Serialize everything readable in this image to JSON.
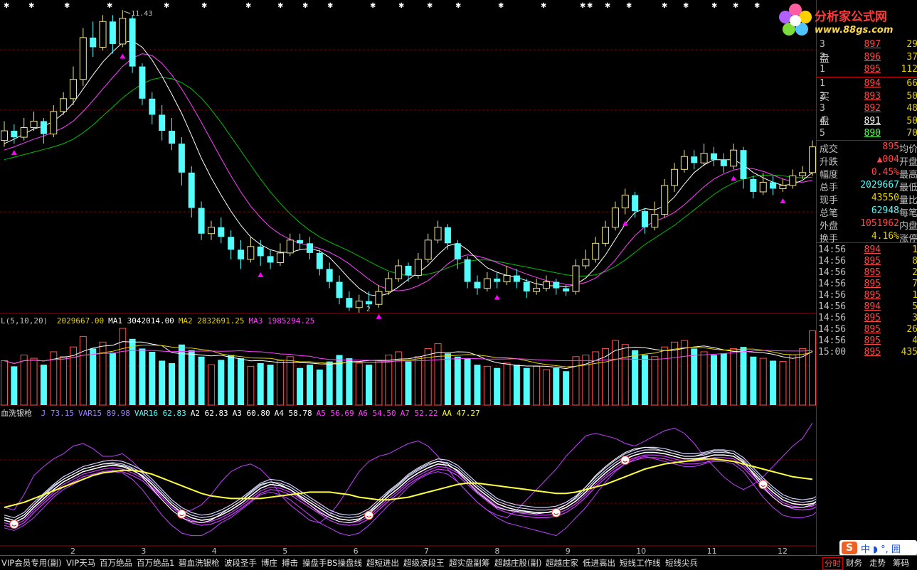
{
  "colors": {
    "up": "#ff5050",
    "up_body": "#f0e68c",
    "down": "#54fcfc",
    "ma_white": "#ffffff",
    "ma_pink": "#ff40ff",
    "ma_green": "#00c000",
    "magenta": "#ff00ff",
    "yellow": "#ffff40",
    "grid": "#7a0000"
  },
  "top_indicator_labels": [
    "11.43"
  ],
  "low_label": "2",
  "volume_panel": {
    "title": "L(5,10,20)",
    "items": [
      {
        "label": "2029667.00",
        "color": "#e6d200"
      },
      {
        "label": "MA1 3042014.00",
        "color": "#ffffff"
      },
      {
        "label": "MA2 2832691.25",
        "color": "#e6d200"
      },
      {
        "label": "MA3 1985294.25",
        "color": "#ff40ff"
      }
    ]
  },
  "indicator_panel": {
    "title": "血洗银枪",
    "items": [
      {
        "label": "J 73.15",
        "color": "#a080ff"
      },
      {
        "label": "VAR15 89.98",
        "color": "#a080ff"
      },
      {
        "label": "VAR16 62.83",
        "color": "#54fcfc"
      },
      {
        "label": "A2 62.83",
        "color": "#ffffff"
      },
      {
        "label": "A3 60.80",
        "color": "#ffffff"
      },
      {
        "label": "A4 58.78",
        "color": "#ffffff"
      },
      {
        "label": "A5 56.69",
        "color": "#ff40ff"
      },
      {
        "label": "A6 54.50",
        "color": "#ff40ff"
      },
      {
        "label": "A7 52.22",
        "color": "#ff40ff"
      },
      {
        "label": "AA 47.27",
        "color": "#ffff40"
      }
    ]
  },
  "chart_data": {
    "type": "candlestick",
    "x_tick_labels": [
      "2",
      "3",
      "4",
      "5",
      "6",
      "7",
      "8",
      "9",
      "10",
      "11",
      "12"
    ],
    "price_max_label": "11.43",
    "candles": [
      [
        9.4,
        9.55,
        9.7,
        9.3
      ],
      [
        9.55,
        9.45,
        9.65,
        9.35
      ],
      [
        9.45,
        9.6,
        9.75,
        9.4
      ],
      [
        9.6,
        9.7,
        9.85,
        9.55
      ],
      [
        9.7,
        9.5,
        9.75,
        9.35
      ],
      [
        9.5,
        9.85,
        9.95,
        9.45
      ],
      [
        9.85,
        10.05,
        10.15,
        9.8
      ],
      [
        10.05,
        10.35,
        10.55,
        9.95
      ],
      [
        10.35,
        11.0,
        11.15,
        10.25
      ],
      [
        11.0,
        10.85,
        11.25,
        10.7
      ],
      [
        10.85,
        11.25,
        11.35,
        10.8
      ],
      [
        11.25,
        10.9,
        11.35,
        10.75
      ],
      [
        10.9,
        11.3,
        11.43,
        10.85
      ],
      [
        11.3,
        10.55,
        11.35,
        10.45
      ],
      [
        10.55,
        10.05,
        10.6,
        9.95
      ],
      [
        10.05,
        9.8,
        10.15,
        9.65
      ],
      [
        9.8,
        9.55,
        9.95,
        9.4
      ],
      [
        9.55,
        9.35,
        9.75,
        9.25
      ],
      [
        9.35,
        8.9,
        9.45,
        8.7
      ],
      [
        8.9,
        8.35,
        9.0,
        8.2
      ],
      [
        8.35,
        7.95,
        8.45,
        7.85
      ],
      [
        7.95,
        8.05,
        8.15,
        7.85
      ],
      [
        8.05,
        7.9,
        8.2,
        7.8
      ],
      [
        7.9,
        7.7,
        8.0,
        7.55
      ],
      [
        7.7,
        7.55,
        7.85,
        7.4
      ],
      [
        7.55,
        7.75,
        7.9,
        7.5
      ],
      [
        7.75,
        7.6,
        7.85,
        7.45
      ],
      [
        7.6,
        7.5,
        7.7,
        7.4
      ],
      [
        7.5,
        7.65,
        7.8,
        7.45
      ],
      [
        7.65,
        7.85,
        7.95,
        7.6
      ],
      [
        7.85,
        7.8,
        7.95,
        7.7
      ],
      [
        7.8,
        7.65,
        7.9,
        7.55
      ],
      [
        7.65,
        7.4,
        7.7,
        7.3
      ],
      [
        7.4,
        7.2,
        7.5,
        7.1
      ],
      [
        7.2,
        6.95,
        7.3,
        6.85
      ],
      [
        6.95,
        6.8,
        7.05,
        6.75
      ],
      [
        6.8,
        6.9,
        7.0,
        6.72
      ],
      [
        6.9,
        6.85,
        7.05,
        6.78
      ],
      [
        6.85,
        7.05,
        7.15,
        6.8
      ],
      [
        7.05,
        7.25,
        7.35,
        7.0
      ],
      [
        7.25,
        7.45,
        7.55,
        7.2
      ],
      [
        7.45,
        7.3,
        7.5,
        7.2
      ],
      [
        7.3,
        7.55,
        7.65,
        7.25
      ],
      [
        7.55,
        7.85,
        7.95,
        7.5
      ],
      [
        7.85,
        8.05,
        8.15,
        7.8
      ],
      [
        8.05,
        7.8,
        8.1,
        7.7
      ],
      [
        7.8,
        7.55,
        7.85,
        7.4
      ],
      [
        7.55,
        7.2,
        7.6,
        7.1
      ],
      [
        7.2,
        7.1,
        7.3,
        7.0
      ],
      [
        7.1,
        7.25,
        7.35,
        7.05
      ],
      [
        7.25,
        7.2,
        7.35,
        7.1
      ],
      [
        7.2,
        7.3,
        7.45,
        7.15
      ],
      [
        7.3,
        7.2,
        7.4,
        7.1
      ],
      [
        7.2,
        7.05,
        7.25,
        6.95
      ],
      [
        7.05,
        7.1,
        7.25,
        7.0
      ],
      [
        7.1,
        7.2,
        7.3,
        7.05
      ],
      [
        7.2,
        7.1,
        7.25,
        7.0
      ],
      [
        7.1,
        7.05,
        7.15,
        6.98
      ],
      [
        7.05,
        7.45,
        7.55,
        7.0
      ],
      [
        7.45,
        7.55,
        7.7,
        7.4
      ],
      [
        7.55,
        7.8,
        7.9,
        7.5
      ],
      [
        7.8,
        8.05,
        8.15,
        7.75
      ],
      [
        8.05,
        8.35,
        8.45,
        8.0
      ],
      [
        8.35,
        8.55,
        8.65,
        8.25
      ],
      [
        8.55,
        8.3,
        8.6,
        8.2
      ],
      [
        8.3,
        8.05,
        8.35,
        7.95
      ],
      [
        8.05,
        8.25,
        8.45,
        8.0
      ],
      [
        8.25,
        8.7,
        8.8,
        8.2
      ],
      [
        8.7,
        8.95,
        9.05,
        8.6
      ],
      [
        8.95,
        9.15,
        9.25,
        8.9
      ],
      [
        9.15,
        9.05,
        9.25,
        8.95
      ],
      [
        9.05,
        9.2,
        9.35,
        9.0
      ],
      [
        9.2,
        9.1,
        9.3,
        9.0
      ],
      [
        9.1,
        9.0,
        9.2,
        8.9
      ],
      [
        9.0,
        9.25,
        9.35,
        8.95
      ],
      [
        9.25,
        8.8,
        9.3,
        8.65
      ],
      [
        8.8,
        8.6,
        8.85,
        8.5
      ],
      [
        8.6,
        8.75,
        8.9,
        8.55
      ],
      [
        8.75,
        8.65,
        8.85,
        8.55
      ],
      [
        8.65,
        8.7,
        8.8,
        8.6
      ],
      [
        8.7,
        8.85,
        8.95,
        8.65
      ],
      [
        8.85,
        8.9,
        9.0,
        8.8
      ],
      [
        8.9,
        9.3,
        9.4,
        8.85
      ]
    ],
    "ma_white": [
      9.35,
      9.42,
      9.5,
      9.58,
      9.62,
      9.7,
      9.82,
      9.98,
      10.2,
      10.42,
      10.62,
      10.78,
      10.92,
      10.95,
      10.85,
      10.65,
      10.4,
      10.12,
      9.82,
      9.48,
      9.12,
      8.82,
      8.55,
      8.3,
      8.08,
      7.9,
      7.78,
      7.7,
      7.66,
      7.66,
      7.7,
      7.72,
      7.68,
      7.58,
      7.42,
      7.25,
      7.1,
      7.0,
      6.98,
      7.02,
      7.12,
      7.24,
      7.34,
      7.46,
      7.62,
      7.76,
      7.8,
      7.7,
      7.55,
      7.42,
      7.35,
      7.3,
      7.27,
      7.22,
      7.17,
      7.14,
      7.14,
      7.12,
      7.16,
      7.26,
      7.42,
      7.62,
      7.86,
      8.1,
      8.28,
      8.34,
      8.32,
      8.38,
      8.52,
      8.72,
      8.9,
      9.02,
      9.1,
      9.1,
      9.1,
      9.02,
      8.9,
      8.82,
      8.75,
      8.7,
      8.72,
      8.78,
      8.9
    ],
    "ma_pink": [
      9.25,
      9.3,
      9.36,
      9.42,
      9.47,
      9.53,
      9.6,
      9.7,
      9.85,
      10.02,
      10.2,
      10.38,
      10.55,
      10.68,
      10.75,
      10.72,
      10.6,
      10.42,
      10.2,
      9.95,
      9.68,
      9.4,
      9.12,
      8.85,
      8.6,
      8.38,
      8.2,
      8.05,
      7.94,
      7.86,
      7.8,
      7.76,
      7.72,
      7.66,
      7.58,
      7.48,
      7.36,
      7.24,
      7.14,
      7.08,
      7.06,
      7.08,
      7.14,
      7.22,
      7.34,
      7.48,
      7.58,
      7.62,
      7.6,
      7.56,
      7.5,
      7.44,
      7.38,
      7.32,
      7.27,
      7.22,
      7.19,
      7.16,
      7.16,
      7.19,
      7.26,
      7.38,
      7.54,
      7.74,
      7.92,
      8.06,
      8.14,
      8.2,
      8.28,
      8.4,
      8.54,
      8.68,
      8.8,
      8.88,
      8.94,
      8.97,
      8.96,
      8.92,
      8.86,
      8.8,
      8.76,
      8.75,
      8.78
    ],
    "ma_green": [
      9.1,
      9.14,
      9.18,
      9.22,
      9.26,
      9.3,
      9.35,
      9.42,
      9.52,
      9.64,
      9.78,
      9.92,
      10.06,
      10.18,
      10.28,
      10.35,
      10.38,
      10.36,
      10.3,
      10.2,
      10.06,
      9.88,
      9.68,
      9.46,
      9.24,
      9.02,
      8.8,
      8.6,
      8.42,
      8.26,
      8.12,
      8.0,
      7.9,
      7.82,
      7.75,
      7.68,
      7.6,
      7.52,
      7.44,
      7.37,
      7.32,
      7.3,
      7.3,
      7.32,
      7.36,
      7.42,
      7.48,
      7.52,
      7.54,
      7.54,
      7.52,
      7.49,
      7.46,
      7.43,
      7.4,
      7.37,
      7.34,
      7.31,
      7.29,
      7.29,
      7.31,
      7.36,
      7.44,
      7.54,
      7.66,
      7.78,
      7.88,
      7.98,
      8.08,
      8.2,
      8.32,
      8.44,
      8.56,
      8.66,
      8.74,
      8.8,
      8.84,
      8.86,
      8.86,
      8.85,
      8.83,
      8.82,
      8.83
    ],
    "volume": [
      0.55,
      0.48,
      0.62,
      0.58,
      0.5,
      0.66,
      0.6,
      0.72,
      0.85,
      0.7,
      0.78,
      0.65,
      0.95,
      0.82,
      0.7,
      0.66,
      0.55,
      0.52,
      0.75,
      0.68,
      0.6,
      0.5,
      0.56,
      0.62,
      0.58,
      0.48,
      0.52,
      0.5,
      0.55,
      0.6,
      0.46,
      0.5,
      0.44,
      0.54,
      0.62,
      0.58,
      0.52,
      0.5,
      0.55,
      0.62,
      0.66,
      0.54,
      0.6,
      0.7,
      0.76,
      0.64,
      0.6,
      0.58,
      0.5,
      0.48,
      0.46,
      0.52,
      0.5,
      0.46,
      0.48,
      0.44,
      0.46,
      0.42,
      0.6,
      0.62,
      0.66,
      0.7,
      0.8,
      0.75,
      0.68,
      0.62,
      0.6,
      0.72,
      0.78,
      0.8,
      0.7,
      0.66,
      0.62,
      0.64,
      0.7,
      0.72,
      0.6,
      0.58,
      0.55,
      0.54,
      0.62,
      0.7,
      0.92
    ],
    "ind_yellow": [
      30,
      32,
      34,
      37,
      40,
      43,
      46,
      49,
      52,
      55,
      57,
      58,
      59,
      59,
      58,
      56,
      53,
      50,
      47,
      44,
      41,
      39,
      38,
      37,
      37,
      37,
      37,
      38,
      39,
      40,
      41,
      42,
      42,
      42,
      41,
      40,
      38,
      37,
      36,
      36,
      37,
      38,
      40,
      42,
      44,
      46,
      48,
      49,
      49,
      48,
      47,
      46,
      45,
      44,
      43,
      42,
      41,
      41,
      42,
      44,
      46,
      48,
      51,
      54,
      57,
      60,
      62,
      64,
      65,
      66,
      67,
      68,
      68,
      67,
      66,
      64,
      62,
      60,
      58,
      56,
      54,
      53,
      52
    ],
    "ind_white": [
      22,
      20,
      24,
      32,
      40,
      47,
      52,
      56,
      60,
      62,
      64,
      64,
      63,
      60,
      54,
      45,
      36,
      28,
      22,
      19,
      18,
      20,
      25,
      30,
      35,
      42,
      48,
      50,
      48,
      44,
      38,
      32,
      26,
      22,
      19,
      18,
      20,
      26,
      34,
      42,
      48,
      55,
      60,
      64,
      66,
      64,
      58,
      50,
      42,
      36,
      30,
      28,
      27,
      26,
      25,
      26,
      28,
      32,
      38,
      46,
      55,
      62,
      68,
      73,
      76,
      77,
      76,
      74,
      72,
      70,
      70,
      72,
      74,
      74,
      72,
      66,
      56,
      46,
      38,
      32,
      30,
      30,
      32,
      38,
      46,
      56,
      62
    ],
    "ind_mag": [
      20,
      18,
      22,
      30,
      37,
      44,
      50,
      54,
      58,
      60,
      62,
      63,
      62,
      59,
      55,
      48,
      40,
      32,
      26,
      22,
      20,
      21,
      24,
      28,
      33,
      39,
      45,
      48,
      47,
      44,
      39,
      34,
      29,
      24,
      21,
      20,
      21,
      25,
      32,
      39,
      45,
      52,
      57,
      61,
      64,
      63,
      59,
      52,
      45,
      39,
      33,
      30,
      28,
      27,
      26,
      26,
      27,
      30,
      35,
      42,
      50,
      57,
      63,
      68,
      71,
      73,
      73,
      72,
      70,
      68,
      68,
      69,
      71,
      71,
      70,
      65,
      57,
      49,
      42,
      36,
      33,
      32,
      33,
      37,
      44,
      52,
      58
    ],
    "ind_upper": [
      30,
      28,
      40,
      55,
      62,
      68,
      72,
      78,
      80,
      76,
      70,
      70,
      72,
      66,
      58,
      48,
      38,
      30,
      26,
      28,
      32,
      40,
      50,
      58,
      62,
      64,
      60,
      52,
      40,
      32,
      26,
      20,
      18,
      24,
      34,
      46,
      58,
      66,
      70,
      72,
      76,
      80,
      82,
      78,
      70,
      60,
      50,
      42,
      34,
      28,
      24,
      22,
      28,
      36,
      44,
      52,
      60,
      70,
      78,
      86,
      88,
      86,
      84,
      80,
      78,
      82,
      86,
      90,
      92,
      88,
      80,
      70,
      62,
      54,
      48,
      44,
      48,
      54,
      62,
      70,
      78,
      84,
      96
    ],
    "ind_lower": [
      14,
      12,
      16,
      22,
      30,
      38,
      44,
      48,
      52,
      55,
      57,
      58,
      57,
      52,
      44,
      34,
      24,
      16,
      10,
      8,
      8,
      12,
      18,
      22,
      28,
      34,
      40,
      42,
      40,
      36,
      30,
      24,
      18,
      14,
      10,
      8,
      10,
      16,
      24,
      32,
      38,
      46,
      52,
      56,
      58,
      56,
      50,
      42,
      34,
      28,
      22,
      18,
      16,
      14,
      12,
      10,
      8,
      14,
      22,
      30,
      40,
      50,
      58,
      64,
      68,
      70,
      68,
      66,
      64,
      62,
      62,
      64,
      66,
      66,
      64,
      58,
      48,
      38,
      30,
      24,
      22,
      22,
      24,
      30,
      38,
      48,
      56
    ]
  },
  "quote": {
    "logo": {
      "name": "分析家公式网",
      "url": "www.88gs.com"
    },
    "sell": [
      {
        "idx": "3",
        "price": "897",
        "vol": "29",
        "color": "#ff4848"
      },
      {
        "idx": "2",
        "price": "896",
        "vol": "37",
        "color": "#ff4848"
      },
      {
        "idx": "1",
        "price": "895",
        "vol": "112",
        "color": "#ff4848"
      }
    ],
    "sell_label": [
      "盘"
    ],
    "buy": [
      {
        "idx": "1",
        "price": "894",
        "vol": "66",
        "color": "#ff4848"
      },
      {
        "idx": "2",
        "price": "893",
        "vol": "50",
        "color": "#ff4848"
      },
      {
        "idx": "3",
        "price": "892",
        "vol": "48",
        "color": "#ff4848"
      },
      {
        "idx": "4",
        "price": "891",
        "vol": "50",
        "color": "#ffffff"
      },
      {
        "idx": "5",
        "price": "890",
        "vol": "70",
        "color": "#54fc54"
      }
    ],
    "buy_label": [
      "买",
      "盘"
    ],
    "stats": [
      {
        "k": "成交",
        "v": "895",
        "k2": "均价",
        "color": "#ff4848"
      },
      {
        "k": "升跌",
        "v": "▲004",
        "k2": "开盘",
        "color": "#ff4848"
      },
      {
        "k": "幅度",
        "v": "0.45%",
        "k2": "最高",
        "color": "#ff4848"
      },
      {
        "k": "总手",
        "v": "2029667",
        "k2": "最低",
        "color": "#54fcfc"
      },
      {
        "k": "现手",
        "v": "43550",
        "k2": "量比",
        "color": "#e6d200"
      },
      {
        "k": "总笔",
        "v": "62948",
        "k2": "每笔",
        "color": "#54fcfc"
      },
      {
        "k": "外盘",
        "v": "1051962",
        "k2": "内盘",
        "color": "#ff4848"
      },
      {
        "k": "换手",
        "v": "4.16%",
        "k2": "涨停",
        "color": "#e6d200"
      }
    ],
    "ticks": [
      {
        "t": "14:56",
        "p": "894",
        "v": "1"
      },
      {
        "t": "14:56",
        "p": "895",
        "v": "8"
      },
      {
        "t": "14:56",
        "p": "895",
        "v": "2"
      },
      {
        "t": "14:56",
        "p": "895",
        "v": "7"
      },
      {
        "t": "14:56",
        "p": "895",
        "v": "1"
      },
      {
        "t": "14:56",
        "p": "894",
        "v": "5"
      },
      {
        "t": "14:56",
        "p": "895",
        "v": "3"
      },
      {
        "t": "14:56",
        "p": "895",
        "v": "26"
      },
      {
        "t": "14:56",
        "p": "895",
        "v": "4"
      },
      {
        "t": "15:00",
        "p": "895",
        "v": "435"
      }
    ]
  },
  "tabs": [
    "VIP会员专用(副)",
    "VIP天马",
    "百万绝品",
    "百万绝品1",
    "碧血洗银枪",
    "波段圣手",
    "博庄",
    "搏击",
    "操盘手BS操盘线",
    "超短进出",
    "超级波段王",
    "超实盘副筹",
    "超越庄股(副)",
    "超越庄家",
    "低进高出",
    "短线工作线",
    "短线尖兵"
  ],
  "right_tabs": [
    "分时",
    "财务",
    "走势",
    "筹码"
  ],
  "ime": {
    "label": "中",
    "extra": "◗ °, 囲"
  }
}
